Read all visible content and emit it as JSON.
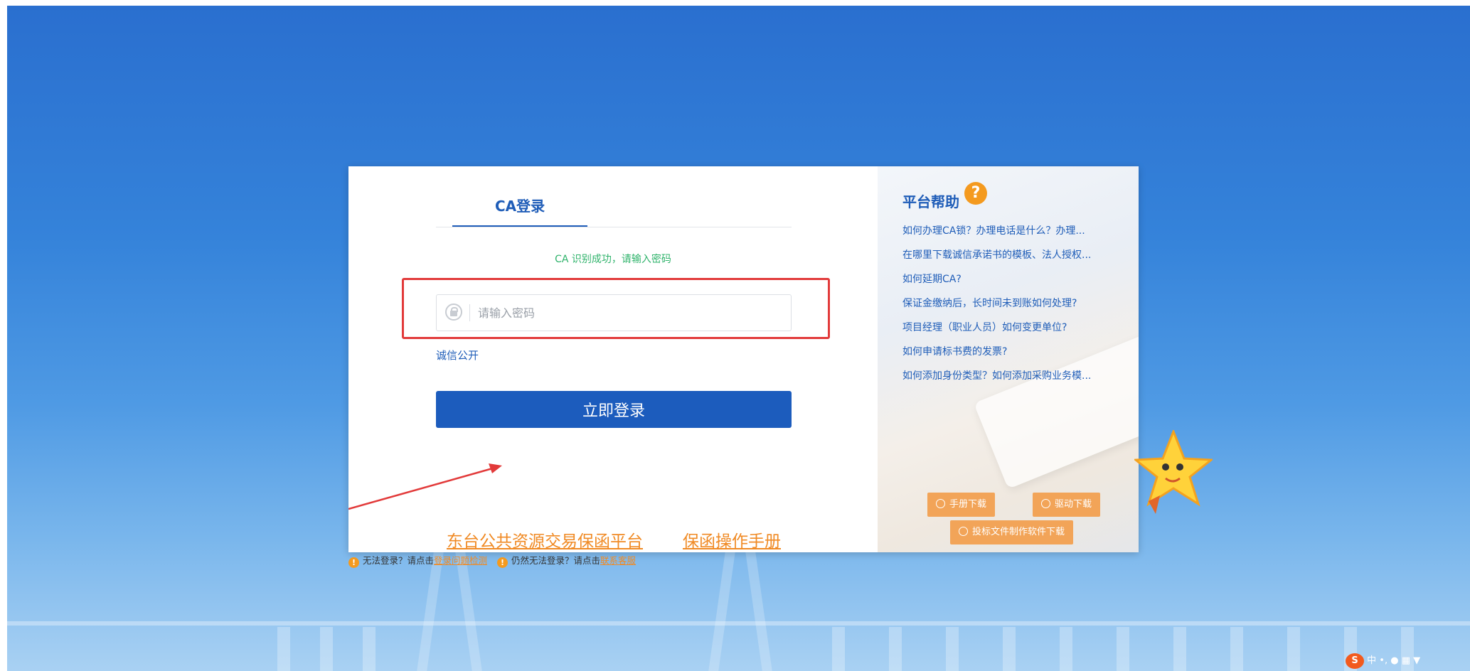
{
  "login": {
    "tab_label": "CA登录",
    "status_text": "CA 识别成功，请输入密码",
    "password_placeholder": "请输入密码",
    "integrity_link": "诚信公开",
    "login_button": "立即登录"
  },
  "footer_links": {
    "platform": "东台公共资源交易保函平台",
    "manual": "保函操作手册"
  },
  "notes": {
    "prefix_1": "无法登录？请点击",
    "link_1": "登录问题检测",
    "prefix_2": "仍然无法登录？请点击",
    "link_2": "联系客服"
  },
  "help": {
    "title": "平台帮助",
    "question_icon": "?",
    "items": [
      "如何办理CA锁？办理电话是什么？办理...",
      "在哪里下载诚信承诺书的模板、法人授权...",
      "如何延期CA?",
      "保证金缴纳后，长时间未到账如何处理?",
      "项目经理（职业人员）如何变更单位?",
      "如何申请标书费的发票?",
      "如何添加身份类型？如何添加采购业务模..."
    ],
    "downloads": {
      "manual": "手册下载",
      "driver": "驱动下载",
      "bid_software": "投标文件制作软件下载"
    }
  },
  "ime": {
    "logo": "S",
    "lang": "中"
  },
  "colors": {
    "brand_blue": "#1c5cbd",
    "success_green": "#2fb36b",
    "warning_orange": "#f08a24",
    "highlight_red": "#e23a3a"
  }
}
